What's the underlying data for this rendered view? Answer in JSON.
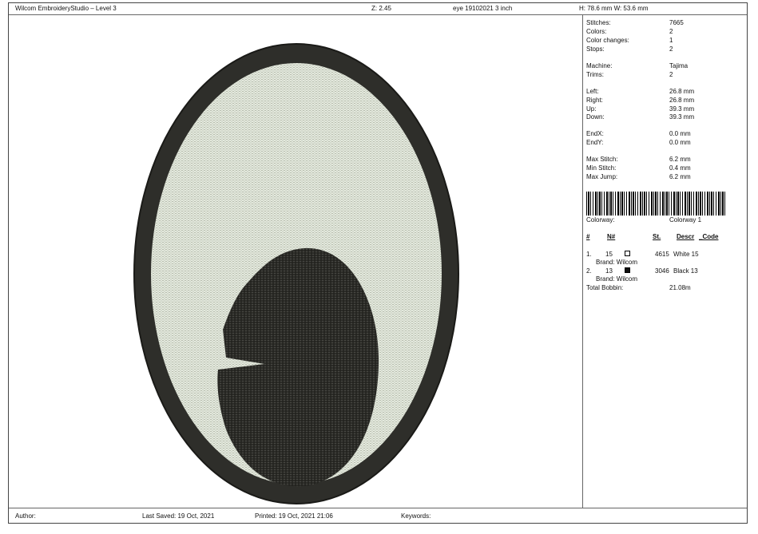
{
  "header": {
    "app_title": "Wilcom EmbroideryStudio – Level 3",
    "zoom": "Z: 2.45",
    "design_name": "eye 19102021 3 inch",
    "dimensions": "H: 78.6 mm   W: 53.6 mm"
  },
  "stats": [
    {
      "label": "Stitches:",
      "value": "7665"
    },
    {
      "label": "Colors:",
      "value": "2"
    },
    {
      "label": "Color changes:",
      "value": "1"
    },
    {
      "label": "Stops:",
      "value": "2"
    },
    {
      "label": "Machine:",
      "value": "Tajima"
    },
    {
      "label": "Trims:",
      "value": "2"
    },
    {
      "label": "Left:",
      "value": "26.8 mm"
    },
    {
      "label": "Right:",
      "value": "26.8 mm"
    },
    {
      "label": "Up:",
      "value": "39.3 mm"
    },
    {
      "label": "Down:",
      "value": "39.3 mm"
    },
    {
      "label": "EndX:",
      "value": "0.0 mm"
    },
    {
      "label": "EndY:",
      "value": "0.0 mm"
    },
    {
      "label": "Max Stitch:",
      "value": "6.2 mm"
    },
    {
      "label": "Min Stitch:",
      "value": "0.4 mm"
    },
    {
      "label": "Max Jump:",
      "value": "6.2 mm"
    }
  ],
  "colorway": {
    "label": "Colorway:",
    "value": "Colorway 1"
  },
  "table": {
    "headers": {
      "num": "#",
      "n": "N#",
      "st": "St.",
      "descr": "Descr",
      "code": "_Code"
    },
    "rows": [
      {
        "num": "1.",
        "n": "15",
        "swatch": "#ffffff",
        "st": "4615",
        "descr": "White 15",
        "brand": "Brand: Wilcom"
      },
      {
        "num": "2.",
        "n": "13",
        "swatch": "#111111",
        "st": "3046",
        "descr": "Black 13",
        "brand": "Brand: Wilcom"
      }
    ],
    "total_label": "Total Bobbin:",
    "total_value": "21.08m"
  },
  "footer": {
    "author": "Author:",
    "last_saved": "Last Saved: 19 Oct, 2021",
    "printed": "Printed: 19 Oct, 2021 21:06",
    "keywords": "Keywords:"
  },
  "colors": {
    "thread_white": "#dfe6d8",
    "thread_black": "#2b2b27"
  }
}
